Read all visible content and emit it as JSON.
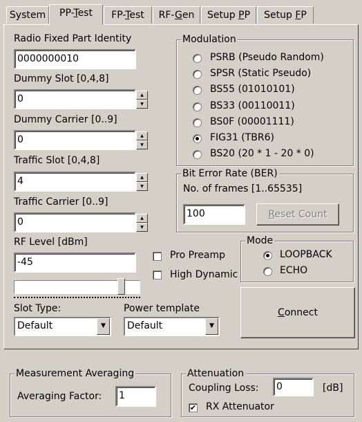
{
  "tabs": [
    {
      "label": "System",
      "underline": "",
      "rest": ""
    },
    {
      "label": "PP-",
      "underline": "T",
      "rest": "est"
    },
    {
      "label": "FP-",
      "underline": "T",
      "rest": "est"
    },
    {
      "label": "RF-",
      "underline": "G",
      "rest": "en"
    },
    {
      "label": "Setup ",
      "underline": "P",
      "rest": "P"
    },
    {
      "label": "Setup ",
      "underline": "F",
      "rest": "P"
    }
  ],
  "fields": {
    "rfpi_label": "Radio Fixed Part Identity",
    "rfpi_value": "0000000010",
    "dummy_slot_label": "Dummy Slot [0,4,8]",
    "dummy_slot_value": "0",
    "dummy_carrier_label": "Dummy Carrier [0..9]",
    "dummy_carrier_value": "0",
    "traffic_slot_label": "Traffic Slot [0,4,8]",
    "traffic_slot_value": "4",
    "traffic_carrier_label": "Traffic Carrier [0..9]",
    "traffic_carrier_value": "0",
    "rf_level_label": "RF Level [dBm]",
    "rf_level_value": "-45",
    "rf_slider_level": 0.87
  },
  "modulation": {
    "legend": "Modulation",
    "options": [
      {
        "label": "PSRB (Pseudo Random)",
        "selected": false
      },
      {
        "label": "SPSR (Static Pseudo)",
        "selected": false
      },
      {
        "label": "BS55 (01010101)",
        "selected": false
      },
      {
        "label": "BS33 (00110011)",
        "selected": false
      },
      {
        "label": "BS0F (00001111)",
        "selected": false
      },
      {
        "label": "FIG31 (TBR6)",
        "selected": true
      },
      {
        "label": "BS20 (20 * 1 - 20 * 0)",
        "selected": false
      }
    ]
  },
  "ber": {
    "legend": "Bit Error Rate (BER)",
    "frames_label": "No. of frames [1..65535]",
    "frames_value": "100",
    "reset_pre": "",
    "reset_underline": "R",
    "reset_rest": "eset Count"
  },
  "checks": {
    "pro_preamp": "Pro Preamp",
    "pro_preamp_checked": false,
    "high_dynamic": "High Dynamic",
    "high_dynamic_checked": false
  },
  "mode": {
    "legend": "Mode",
    "options": [
      {
        "label": "LOOPBACK",
        "selected": true
      },
      {
        "label": "ECHO",
        "selected": false
      }
    ]
  },
  "slot_type": {
    "label": "Slot Type:",
    "value": "Default"
  },
  "power_template": {
    "label": "Power template",
    "value": "Default"
  },
  "connect": {
    "underline": "C",
    "rest": "onnect"
  },
  "averaging": {
    "legend": "Measurement Averaging",
    "factor_label": "Averaging Factor:",
    "factor_value": "1"
  },
  "attenuation": {
    "legend": "Attenuation",
    "coupling_label": "Coupling Loss:",
    "coupling_value": "0",
    "unit": "[dB]",
    "rx_label": "RX Attenuator",
    "rx_checked": true
  }
}
